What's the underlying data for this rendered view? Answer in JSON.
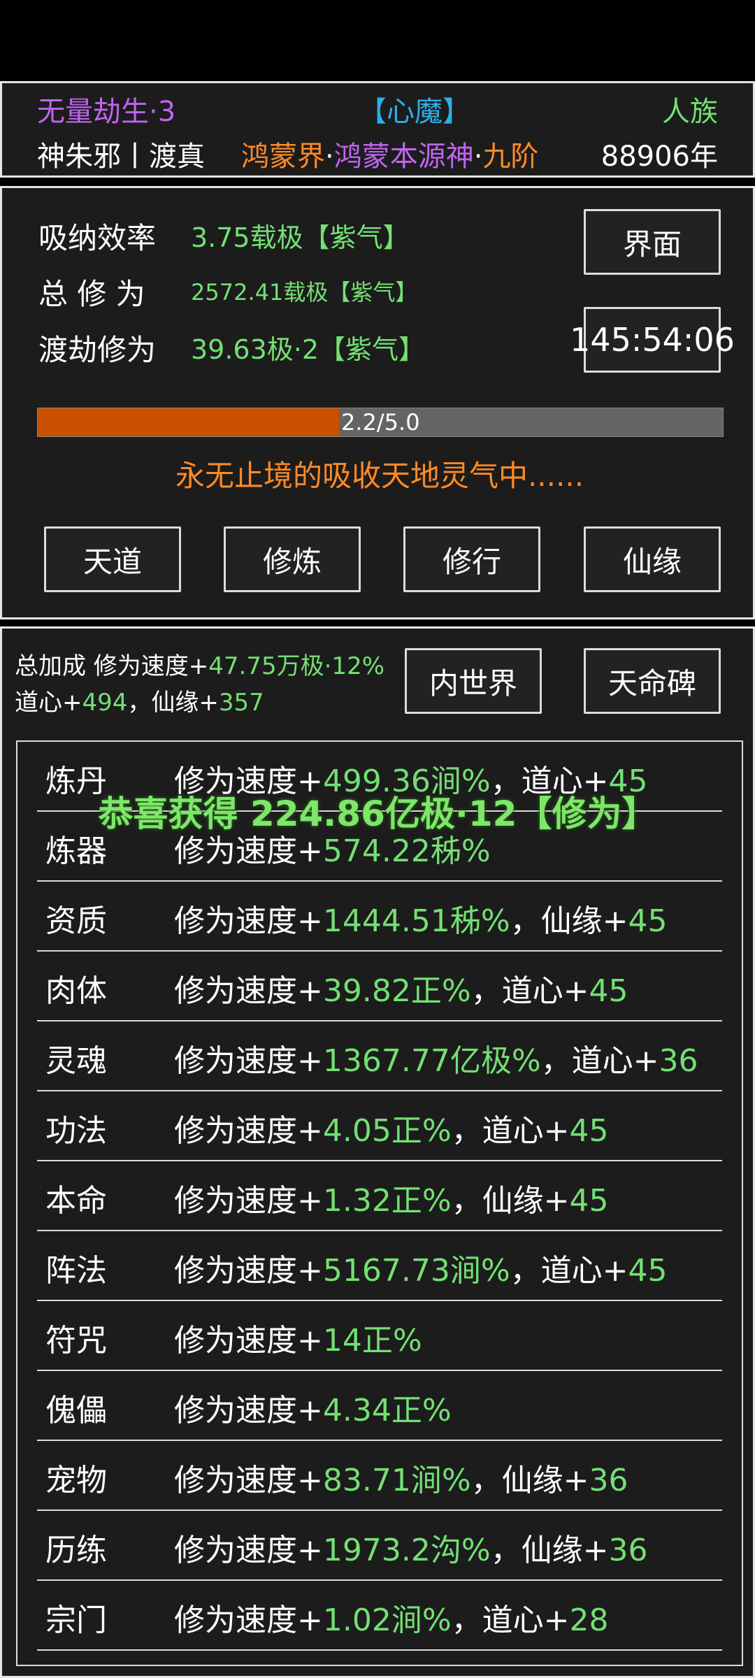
{
  "header": {
    "realm_title": "无量劫生·3",
    "state": "【心魔】",
    "race": "人族",
    "char_name": "神朱邪丨渡真",
    "world_1": "鸿蒙界",
    "dot_1": "·",
    "world_2": "鸿蒙本源神",
    "dot_2": "·",
    "world_3": "九阶",
    "age": "88906年"
  },
  "cultivation": {
    "rate_label": "吸纳效率",
    "rate_value": "3.75载极【紫气】",
    "total_label": "总 修 为",
    "total_value": "2572.41载极【紫气】",
    "tribulation_label": "渡劫修为",
    "tribulation_value": "39.63极·2【紫气】",
    "interface_button": "界面",
    "timer": "145:54:06",
    "progress_text": "2.2/5.0",
    "progress_fraction": 0.44,
    "status": "永无止境的吸收天地灵气中......"
  },
  "actions": [
    "天道",
    "修炼",
    "修行",
    "仙缘"
  ],
  "bonus": {
    "summary_prefix_1": "总加成 修为速度+",
    "summary_value_1": "47.75万极·12%",
    "summary_prefix_2": "道心+",
    "summary_value_2": "494",
    "summary_sep": "，仙缘+",
    "summary_value_3": "357",
    "inner_world_button": "内世界",
    "fate_stele_button": "天命碑"
  },
  "bonus_items": [
    {
      "name": "炼丹",
      "prefix": "修为速度+",
      "value": "499.36涧%",
      "extra_label": "，道心+",
      "extra_value": "45"
    },
    {
      "name": "炼器",
      "prefix": "修为速度+",
      "value": "574.22秭%",
      "extra_label": "",
      "extra_value": ""
    },
    {
      "name": "资质",
      "prefix": "修为速度+",
      "value": "1444.51秭%",
      "extra_label": "，仙缘+",
      "extra_value": "45"
    },
    {
      "name": "肉体",
      "prefix": "修为速度+",
      "value": "39.82正%",
      "extra_label": "，道心+",
      "extra_value": "45"
    },
    {
      "name": "灵魂",
      "prefix": "修为速度+",
      "value": "1367.77亿极%",
      "extra_label": "，道心+",
      "extra_value": "36"
    },
    {
      "name": "功法",
      "prefix": "修为速度+",
      "value": "4.05正%",
      "extra_label": "，道心+",
      "extra_value": "45"
    },
    {
      "name": "本命",
      "prefix": "修为速度+",
      "value": "1.32正%",
      "extra_label": "，仙缘+",
      "extra_value": "45"
    },
    {
      "name": "阵法",
      "prefix": "修为速度+",
      "value": "5167.73涧%",
      "extra_label": "，道心+",
      "extra_value": "45"
    },
    {
      "name": "符咒",
      "prefix": "修为速度+",
      "value": "14正%",
      "extra_label": "",
      "extra_value": ""
    },
    {
      "name": "傀儡",
      "prefix": "修为速度+",
      "value": "4.34正%",
      "extra_label": "",
      "extra_value": ""
    },
    {
      "name": "宠物",
      "prefix": "修为速度+",
      "value": "83.71涧%",
      "extra_label": "，仙缘+",
      "extra_value": "36"
    },
    {
      "name": "历练",
      "prefix": "修为速度+",
      "value": "1973.2沟%",
      "extra_label": "，仙缘+",
      "extra_value": "36"
    },
    {
      "name": "宗门",
      "prefix": "修为速度+",
      "value": "1.02涧%",
      "extra_label": "，道心+",
      "extra_value": "28"
    }
  ],
  "toast": "恭喜获得 224.86亿极·12【修为】",
  "colors": {
    "purple": "#c064f0",
    "cyan": "#2bb0e8",
    "orange": "#ff8a25",
    "green": "#73e073",
    "progress_fill": "#c85000"
  }
}
